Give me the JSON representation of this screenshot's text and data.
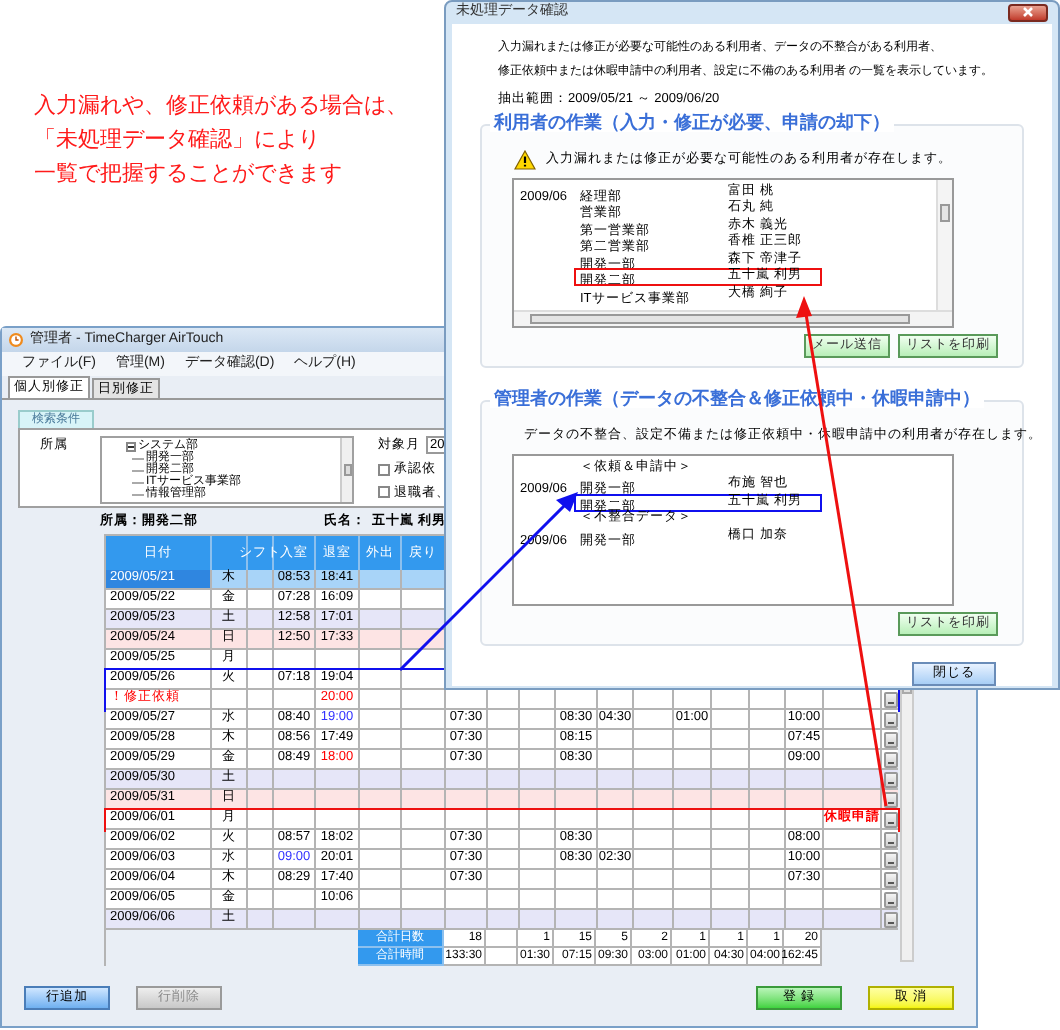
{
  "annotation": {
    "lines": [
      "入力漏れや、修正依頼がある場合は、",
      "「未処理データ確認」により",
      "一覧で把握することができます"
    ]
  },
  "app": {
    "title": "管理者 - TimeCharger AirTouch",
    "menu": [
      "ファイル(F)",
      "管理(M)",
      "データ確認(D)",
      "ヘルプ(H)"
    ],
    "tabs": [
      {
        "label": "個人別修正",
        "selected": true
      },
      {
        "label": "日別修正",
        "selected": false
      }
    ],
    "search": {
      "tab": "検索条件",
      "dept_label": "所属",
      "tree": [
        {
          "label": "システム部",
          "expanded": true,
          "children": [
            {
              "label": "開発一部"
            },
            {
              "label": "開発二部"
            },
            {
              "label": "ITサービス事業部"
            },
            {
              "label": "情報管理部"
            }
          ]
        }
      ],
      "month_label": "対象月",
      "month_value": "20",
      "options": [
        {
          "label": "承認依",
          "checked": false
        },
        {
          "label": "退職者、",
          "checked": false
        }
      ]
    },
    "info": {
      "dept": "所属：開発二部",
      "name_label": "氏名：",
      "name": "五十嵐 利男"
    },
    "table": {
      "columns": [
        "日付",
        "シフト",
        "入室",
        "退室",
        "外出",
        "戻り"
      ],
      "rows": [
        {
          "date": "2009/05/21",
          "weekday": "木",
          "kind": "weekday",
          "selected": true,
          "cells": {
            "in": "08:53",
            "out": "18:41"
          }
        },
        {
          "date": "2009/05/22",
          "weekday": "金",
          "kind": "weekday",
          "selected": false,
          "cells": {
            "in": "07:28",
            "out": "16:09"
          }
        },
        {
          "date": "2009/05/23",
          "weekday": "土",
          "kind": "saturday",
          "selected": false,
          "cells": {
            "in": "12:58",
            "out": "17:01"
          }
        },
        {
          "date": "2009/05/24",
          "weekday": "日",
          "kind": "sunday",
          "selected": false,
          "cells": {
            "in": "12:50",
            "out": "17:33"
          }
        },
        {
          "date": "2009/05/25",
          "weekday": "月",
          "kind": "weekday",
          "selected": false,
          "cells": {}
        },
        {
          "date": "2009/05/26",
          "weekday": "火",
          "kind": "weekday",
          "selected": false,
          "cells": {
            "in": "07:18",
            "out": "19:04"
          }
        },
        {
          "label": {
            "text": "！修正依頼",
            "color": "#ff0000"
          },
          "kind": "note",
          "selected": false,
          "cells": {
            "out": {
              "text": "20:00",
              "color": "#ff0000"
            }
          }
        },
        {
          "date": "2009/05/27",
          "weekday": "水",
          "kind": "weekday",
          "selected": false,
          "cells": {
            "in": "08:40",
            "out": {
              "text": "19:00",
              "color": "#3333ff"
            },
            "column_8": "07:30",
            "column_11": "08:30",
            "column_12": "04:30",
            "column_14": "01:00",
            "column_17": "10:00"
          }
        },
        {
          "date": "2009/05/28",
          "weekday": "木",
          "kind": "weekday",
          "selected": false,
          "cells": {
            "in": "08:56",
            "out": "17:49",
            "column_8": "07:30",
            "column_11": "08:15",
            "column_17": "07:45"
          }
        },
        {
          "date": "2009/05/29",
          "weekday": "金",
          "kind": "weekday",
          "selected": false,
          "cells": {
            "in": "08:49",
            "out": {
              "text": "18:00",
              "color": "#ff0000"
            },
            "column_8": "07:30",
            "column_11": "08:30",
            "column_17": "09:00"
          }
        },
        {
          "date": "2009/05/30",
          "weekday": "土",
          "kind": "saturday",
          "selected": false,
          "cells": {}
        },
        {
          "date": "2009/05/31",
          "weekday": "日",
          "kind": "sunday",
          "selected": false,
          "cells": {}
        },
        {
          "date": "2009/06/01",
          "weekday": "月",
          "kind": "weekday",
          "selected": false,
          "cells": {
            "column_18": {
              "text": "休暇申請",
              "color": "#ff0000"
            }
          }
        },
        {
          "date": "2009/06/02",
          "weekday": "火",
          "kind": "weekday",
          "selected": false,
          "cells": {
            "in": "08:57",
            "out": "18:02",
            "column_8": "07:30",
            "column_11": "08:30",
            "column_17": "08:00"
          }
        },
        {
          "date": "2009/06/03",
          "weekday": "水",
          "kind": "weekday",
          "selected": false,
          "cells": {
            "in": {
              "text": "09:00",
              "color": "#3333ff"
            },
            "out": "20:01",
            "column_8": "07:30",
            "column_11": "08:30",
            "column_12": "02:30",
            "column_17": "10:00"
          }
        },
        {
          "date": "2009/06/04",
          "weekday": "木",
          "kind": "weekday",
          "selected": false,
          "cells": {
            "in": "08:29",
            "out": "17:40",
            "column_8": "07:30",
            "column_17": "07:30"
          }
        },
        {
          "date": "2009/06/05",
          "weekday": "金",
          "kind": "weekday",
          "selected": false,
          "cells": {
            "out": "10:06"
          }
        },
        {
          "date": "2009/06/06",
          "weekday": "土",
          "kind": "saturday",
          "selected": false,
          "cells": {}
        }
      ],
      "totals": [
        {
          "label": "合計日数",
          "values": {
            "column_8": "18",
            "column_10": "1",
            "column_11": "15",
            "column_12": "5",
            "column_13": "2",
            "column_14": "1",
            "column_15": "1",
            "column_16": "1",
            "column_17": "20"
          }
        },
        {
          "label": "合計時間",
          "values": {
            "column_8": "133:30",
            "column_10": "01:30",
            "column_11": "07:15",
            "column_12": "09:30",
            "column_13": "03:00",
            "column_14": "01:00",
            "column_15": "04:30",
            "column_16": "04:00",
            "column_17": "162:45"
          }
        }
      ]
    },
    "buttons": [
      {
        "label": "行追加",
        "kind": "primary"
      },
      {
        "label": "行削除",
        "kind": "disabled"
      },
      {
        "label": "登 録",
        "kind": "save"
      },
      {
        "label": "取 消",
        "kind": "cancel"
      }
    ]
  },
  "dialog": {
    "title": "未処理データ確認",
    "description": [
      "入力漏れまたは修正が必要な可能性のある利用者、データの不整合がある利用者、",
      "修正依頼中または休暇申請中の利用者、設定に不備のある利用者 の一覧を表示しています。"
    ],
    "range": "抽出範囲：2009/05/21 ～ 2009/06/20",
    "sections": [
      {
        "title": "利用者の作業（入力・修正が必要、申請の却下）",
        "warning": "入力漏れまたは修正が必要な可能性のある利用者が存在します。",
        "scrollable": true,
        "items": [
          {
            "kind": "entry",
            "month": "2009/06",
            "dept": "経理部",
            "name": "富田 桃"
          },
          {
            "kind": "entry",
            "dept": "営業部",
            "name": "石丸 純"
          },
          {
            "kind": "entry",
            "dept": "第一営業部",
            "name": "赤木 義光"
          },
          {
            "kind": "entry",
            "dept": "第二営業部",
            "name": "香椎 正三郎"
          },
          {
            "kind": "entry",
            "dept": "開発一部",
            "name": "森下 帝津子"
          },
          {
            "kind": "entry",
            "dept": "開発二部",
            "name": "五十嵐 利男"
          },
          {
            "kind": "entry",
            "dept": "ITサービス事業部",
            "name": "大橋 絢子"
          }
        ],
        "buttons": [
          {
            "label": "メール送信"
          },
          {
            "label": "リストを印刷"
          }
        ]
      },
      {
        "title": "管理者の作業（データの不整合＆修正依頼中・休暇申請中）",
        "warning": "データの不整合、設定不備または修正依頼中・休暇申請中の利用者が存在します。",
        "scrollable": false,
        "items": [
          {
            "kind": "heading",
            "label": "＜依頼＆申請中＞"
          },
          {
            "kind": "entry",
            "month": "2009/06",
            "dept": "開発一部",
            "name": "布施 智也"
          },
          {
            "kind": "entry",
            "dept": "開発二部",
            "name": "五十嵐 利男"
          },
          {
            "kind": "heading",
            "label": "＜不整合データ＞"
          },
          {
            "kind": "entry",
            "month": "2009/06",
            "dept": "開発一部",
            "name": "橋口 加奈"
          }
        ],
        "buttons": [
          {
            "label": "リストを印刷"
          }
        ]
      }
    ],
    "close": "閉じる"
  }
}
